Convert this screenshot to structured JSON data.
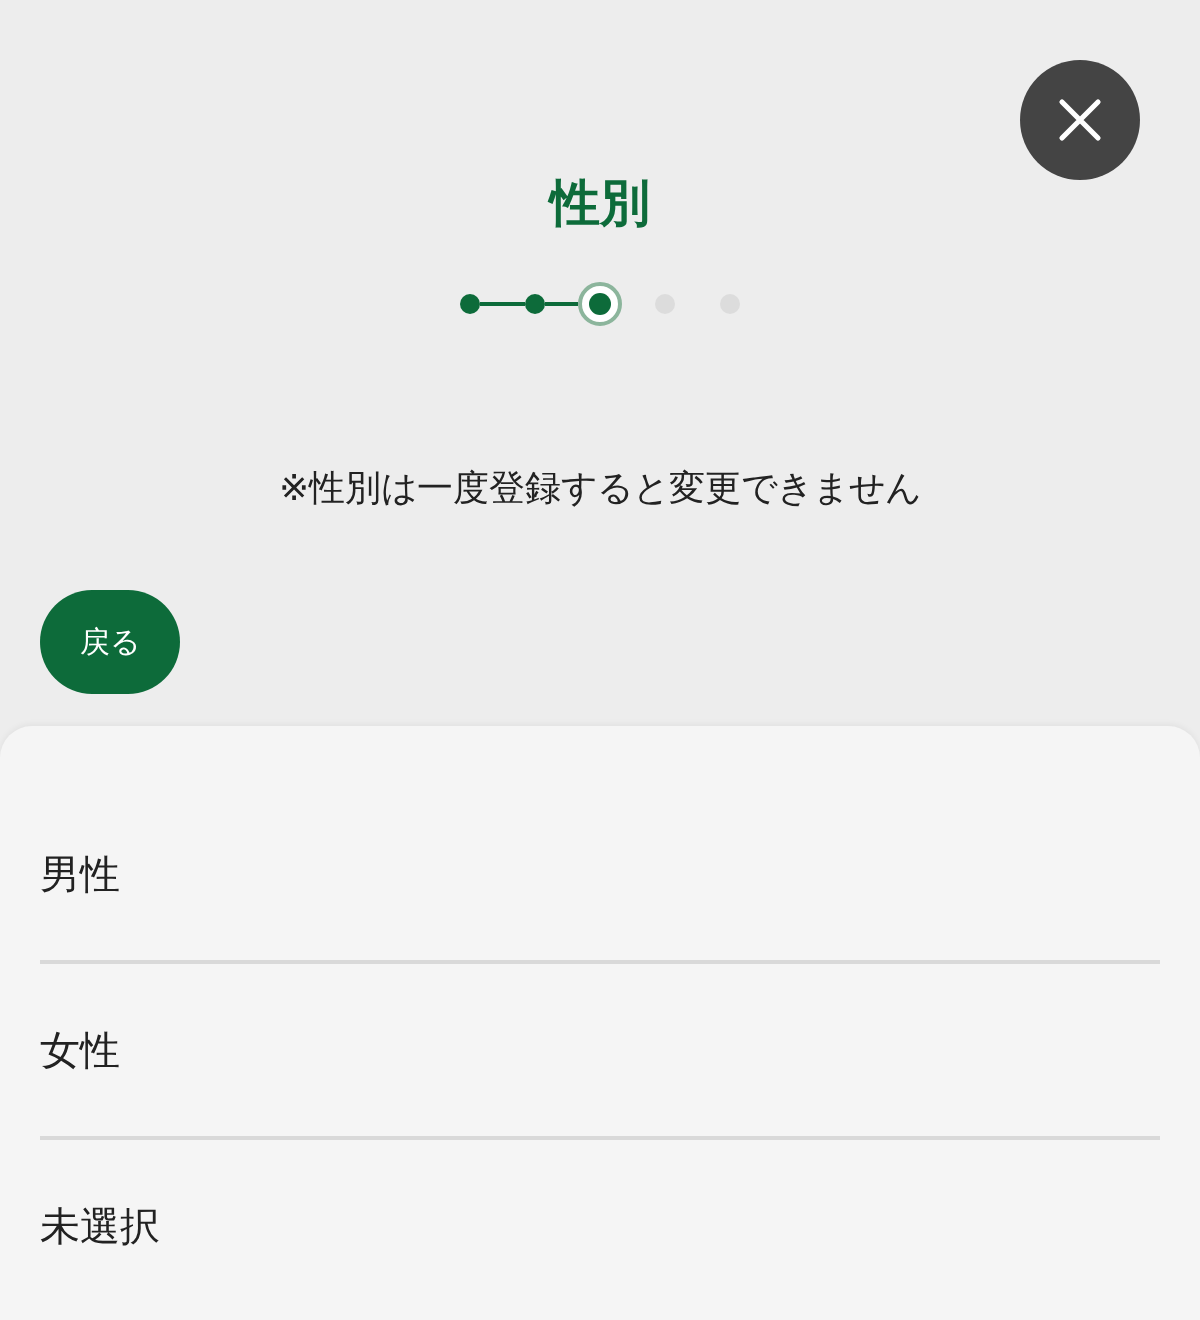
{
  "title": "性別",
  "steps": [
    {
      "completed": true,
      "selected": false
    },
    {
      "completed": true,
      "selected": false
    },
    {
      "completed": false,
      "selected": true
    },
    {
      "completed": false,
      "selected": false
    },
    {
      "completed": false,
      "selected": false
    }
  ],
  "notice": "※性別は一度登録すると変更できません",
  "back_button": {
    "label": "戻る"
  },
  "options": [
    {
      "label": "男性",
      "selected": false
    },
    {
      "label": "女性",
      "selected": false
    },
    {
      "label": "未選択",
      "selected": false
    }
  ]
}
